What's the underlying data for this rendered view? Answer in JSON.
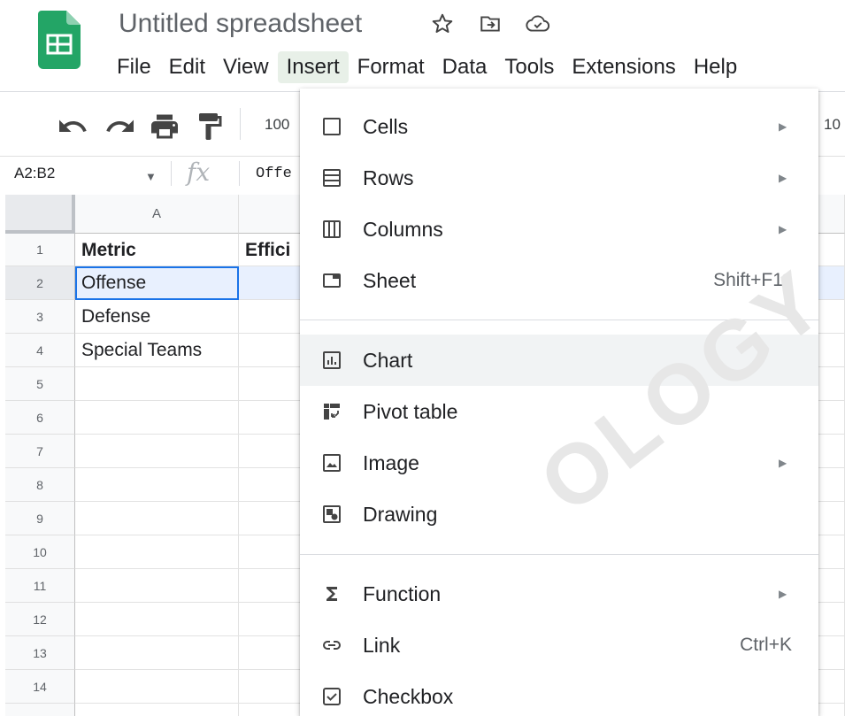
{
  "app": {
    "title": "Untitled spreadsheet",
    "icons": [
      "star-icon",
      "move-to-folder-icon",
      "cloud-saved-icon"
    ]
  },
  "menubar": [
    {
      "label": "File"
    },
    {
      "label": "Edit"
    },
    {
      "label": "View"
    },
    {
      "label": "Insert",
      "active": true
    },
    {
      "label": "Format"
    },
    {
      "label": "Data"
    },
    {
      "label": "Tools"
    },
    {
      "label": "Extensions"
    },
    {
      "label": "Help"
    }
  ],
  "toolbar": {
    "icons": [
      "undo-icon",
      "redo-icon",
      "print-icon",
      "paint-format-icon"
    ],
    "zoom": "100",
    "overflow_text": "10"
  },
  "formula_bar": {
    "name_box": "A2:B2",
    "fx": "fx",
    "content": "Offe"
  },
  "grid": {
    "columns": [
      "A"
    ],
    "column_b_partial": "",
    "rows": [
      "1",
      "2",
      "3",
      "4",
      "5",
      "6",
      "7",
      "8",
      "9",
      "10",
      "11",
      "12",
      "13",
      "14"
    ],
    "cells": {
      "A1": "Metric",
      "B1": "Effici",
      "A2": "Offense",
      "A3": "Defense",
      "A4": "Special Teams"
    }
  },
  "insert_menu": {
    "items": [
      {
        "label": "Cells",
        "icon": "cells-icon",
        "submenu": true
      },
      {
        "label": "Rows",
        "icon": "rows-icon",
        "submenu": true
      },
      {
        "label": "Columns",
        "icon": "columns-icon",
        "submenu": true
      },
      {
        "label": "Sheet",
        "icon": "sheet-icon",
        "shortcut": "Shift+F11"
      },
      {
        "label": "Chart",
        "icon": "chart-icon",
        "highlighted": true
      },
      {
        "label": "Pivot table",
        "icon": "pivot-table-icon"
      },
      {
        "label": "Image",
        "icon": "image-icon",
        "submenu": true
      },
      {
        "label": "Drawing",
        "icon": "drawing-icon"
      },
      {
        "label": "Function",
        "icon": "sigma-icon",
        "submenu": true
      },
      {
        "label": "Link",
        "icon": "link-icon",
        "shortcut": "Ctrl+K"
      },
      {
        "label": "Checkbox",
        "icon": "checkbox-icon"
      }
    ],
    "submenu_arrow": "▶"
  },
  "watermark": "OLOGY"
}
